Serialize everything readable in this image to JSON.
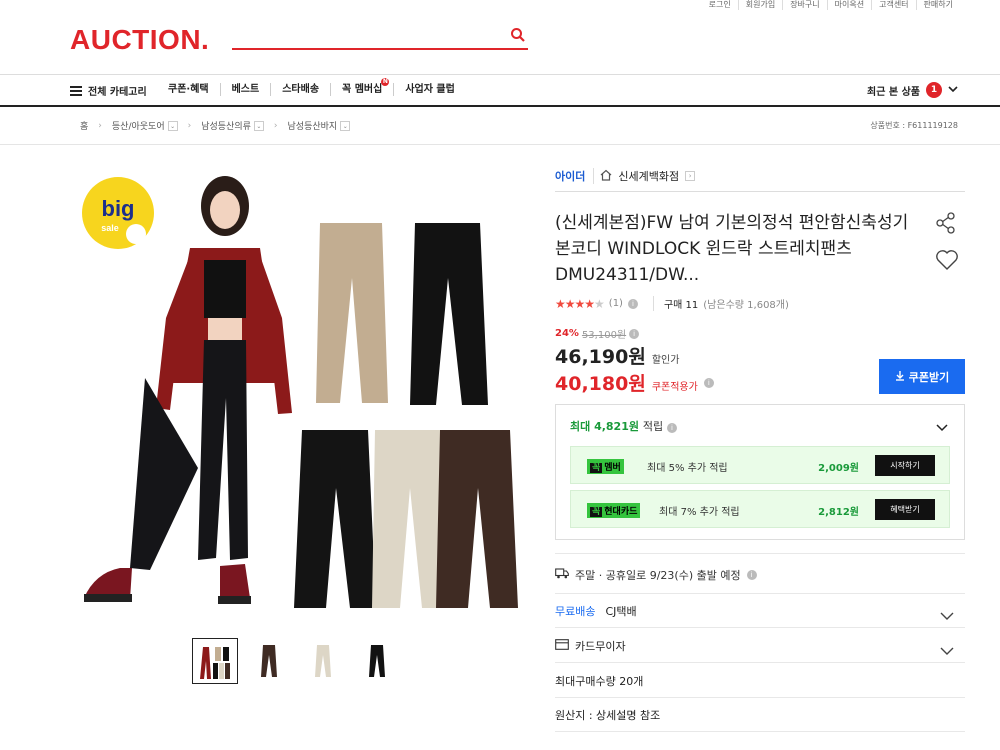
{
  "util_links": [
    "로그인",
    "회원가입",
    "장바구니",
    "마이옥션",
    "고객센터",
    "판매하기"
  ],
  "logo": "AUCTION.",
  "nav": {
    "category_label": "전체 카테고리",
    "menu": [
      "쿠폰·혜택",
      "베스트",
      "스타배송",
      "꼭 멤버십",
      "사업자 클럽"
    ],
    "membership_badge": "N",
    "recent_label": "최근 본 상품",
    "recent_count": "1"
  },
  "breadcrumb": [
    "홈",
    "등산/아웃도어",
    "남성등산의류",
    "남성등산바지"
  ],
  "product_no": "상품번호 : F611119128",
  "image_badge": {
    "line1": "big",
    "line2": "sale"
  },
  "seller": {
    "brand": "아이더",
    "store": "신세계백화점"
  },
  "product": {
    "title": "(신세계본점)FW 남여 기본의정석 편안함신축성기본코디 WINDLOCK 윈드락 스트레치팬츠 DMU24311/DW...",
    "rating_count": "(1)",
    "rating_value": 4,
    "purchase": "구매 11",
    "stock": "(남은수량 1,608개)",
    "discount_pct": "24%",
    "original_price": "53,100원",
    "sale_price": "46,190원",
    "sale_label": "할인가",
    "coupon_price": "40,180원",
    "coupon_label": "쿠폰적용가",
    "coupon_button": "쿠폰받기"
  },
  "points": {
    "head_amount": "최대 4,821원",
    "head_label": "적립",
    "rows": [
      {
        "tag_k": "꼭",
        "tag": "멤버",
        "desc": "최대 5% 추가 적립",
        "amount": "2,009원",
        "button": "시작하기"
      },
      {
        "tag_k": "꼭",
        "tag": "현대카드",
        "desc": "최대 7% 추가 적립",
        "amount": "2,812원",
        "button": "혜택받기"
      }
    ]
  },
  "shipping": {
    "date": "주말 · 공휴일로 9/23(수) 출발 예정",
    "free": "무료배송",
    "carrier": "CJ택배",
    "card": "카드무이자",
    "max_qty": "최대구매수량 20개",
    "origin": "원산지 : 상세설명 참조"
  },
  "colors": {
    "brand_red": "#e0252a",
    "accent_blue": "#1a6bf0",
    "point_green": "#35c43e"
  }
}
